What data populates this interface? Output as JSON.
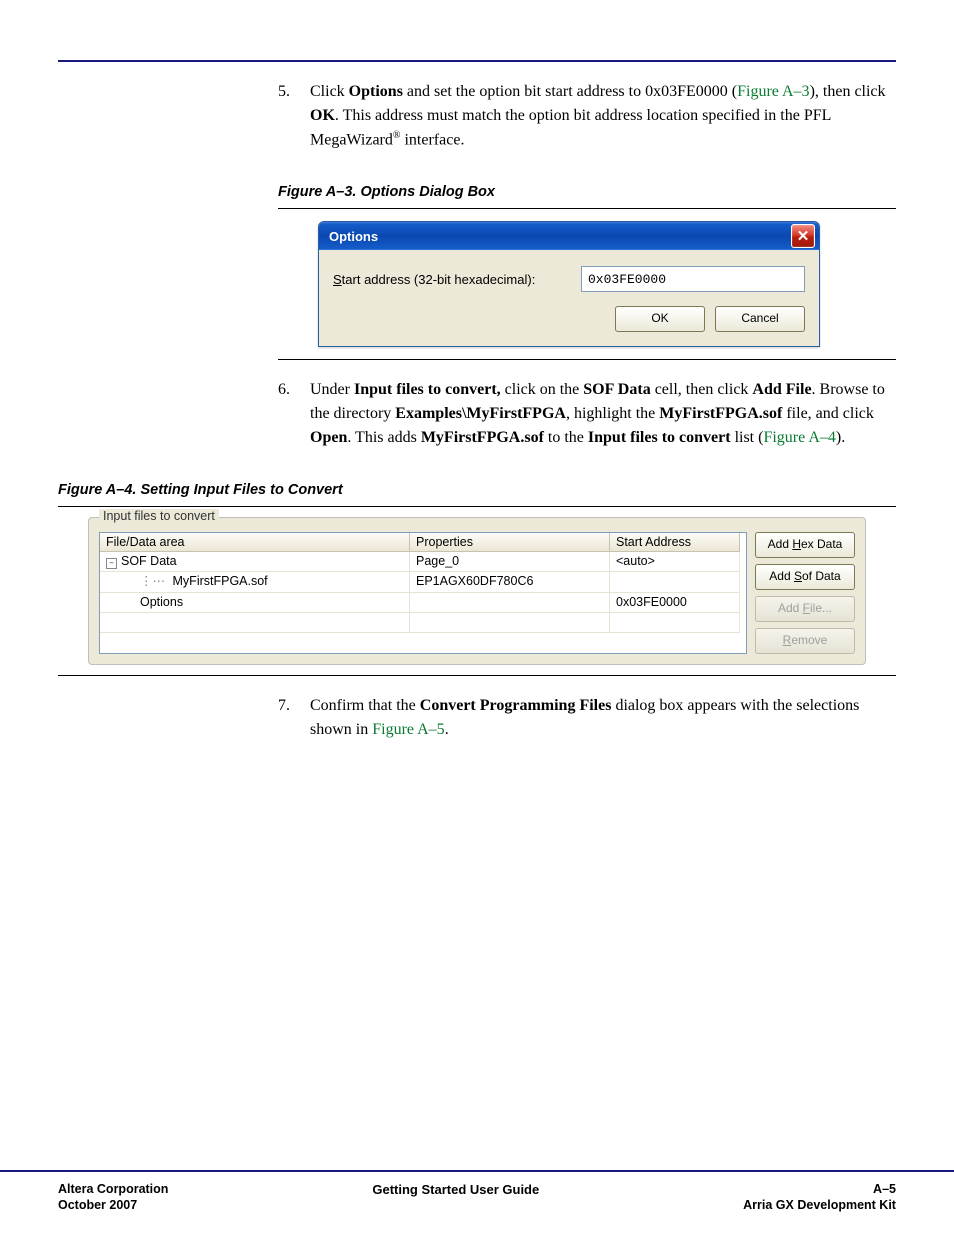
{
  "step5": {
    "num": "5.",
    "prefix": "Click ",
    "options_word": "Options",
    "mid1": " and set the option bit start address to 0x03FE0000 (",
    "figref": "Figure A–3",
    "mid2": "), then click ",
    "ok_word": "OK",
    "mid3": ". This address must match the option bit address location specified in the PFL MegaWizard",
    "reg": "®",
    "tail": " interface."
  },
  "figA3": {
    "caption": "Figure A–3. Options Dialog Box",
    "dialog": {
      "title": "Options",
      "label": "Start address (32-bit hexadecimal):",
      "value": "0x03FE0000",
      "ok": "OK",
      "cancel": "Cancel",
      "close_glyph": "✕",
      "label_accesskey_pos": "S"
    }
  },
  "step6": {
    "num": "6.",
    "t1": "Under ",
    "b1": "Input files to convert,",
    "t2": " click on the ",
    "b2": "SOF Data",
    "t3": " cell, then click ",
    "b3": "Add File",
    "t4": ". Browse to the directory ",
    "b4": "Examples\\MyFirstFPGA",
    "t5": ", highlight the ",
    "b5": "MyFirstFPGA.sof",
    "t6": " file, and click ",
    "b6": "Open",
    "t7": ". This adds ",
    "b7": "MyFirstFPGA.sof",
    "t8": " to the ",
    "b8": "Input files to convert",
    "t9": " list (",
    "figref": "Figure A–4",
    "t10": ")."
  },
  "figA4": {
    "caption": "Figure A–4. Setting Input Files to Convert",
    "legend": "Input files to convert",
    "headers": [
      "File/Data area",
      "Properties",
      "Start Address"
    ],
    "rows": [
      {
        "file": "SOF Data",
        "prop": "Page_0",
        "addr": "<auto>",
        "level": 1,
        "toggle": "–"
      },
      {
        "file": "MyFirstFPGA.sof",
        "prop": "EP1AGX60DF780C6",
        "addr": "",
        "level": 2,
        "prefix": "⋮⋯ "
      },
      {
        "file": "Options",
        "prop": "",
        "addr": "0x03FE0000",
        "level": 3
      }
    ],
    "buttons": {
      "addhex_pre": "Add ",
      "addhex_u": "H",
      "addhex_post": "ex Data",
      "addsof_pre": "Add ",
      "addsof_u": "S",
      "addsof_post": "of Data",
      "addfile_pre": "Add ",
      "addfile_u": "F",
      "addfile_post": "ile...",
      "remove_u": "R",
      "remove_post": "emove"
    }
  },
  "step7": {
    "num": "7.",
    "t1": "Confirm that the ",
    "b1": "Convert Programming Files",
    "t2": " dialog box appears with the selections shown in ",
    "figref": "Figure A–5",
    "t3": "."
  },
  "footer": {
    "left1": "Altera Corporation",
    "left2": "October 2007",
    "center": "Getting Started User Guide",
    "right1": "A–5",
    "right2": "Arria GX Development Kit"
  }
}
